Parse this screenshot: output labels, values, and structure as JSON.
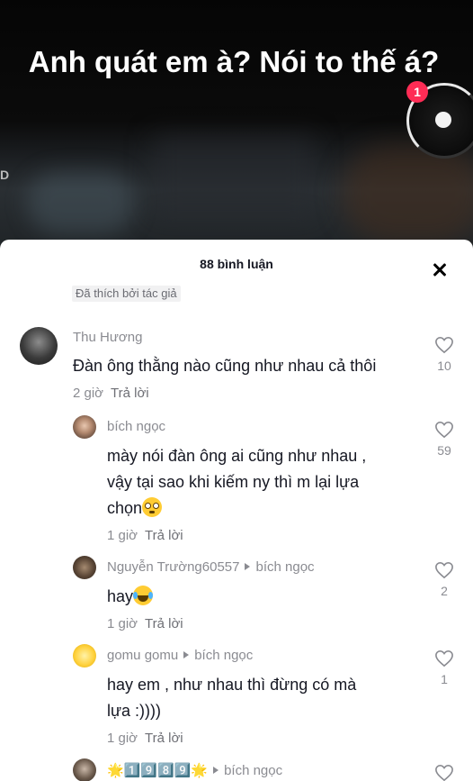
{
  "video": {
    "caption": "Anh quát em à? Nói to thế á?",
    "side_letter": "D",
    "notification_count": "1"
  },
  "sheet": {
    "title": "88 bình luận",
    "liked_by_author": "Đã thích bởi tác giả"
  },
  "comments": [
    {
      "user": "Thu Hương",
      "text": "Đàn ông thằng nào cũng như nhau cả thôi",
      "time": "2 giờ",
      "reply": "Trả lời",
      "likes": "10"
    },
    {
      "user": "bích ngọc",
      "text_line1": "mày nói đàn ông ai cũng như nhau ,",
      "text_line2": "vậy tại sao khi kiếm ny thì m lại lựa",
      "text_line3": "chọn",
      "time": "1 giờ",
      "reply": "Trả lời",
      "likes": "59"
    },
    {
      "user": "Nguyễn Trường60557",
      "reply_to": "bích ngọc",
      "text": "hay",
      "time": "1 giờ",
      "reply": "Trả lời",
      "likes": "2"
    },
    {
      "user": "gomu gomu",
      "reply_to": "bích ngọc",
      "text_line1": "hay em , như nhau thì đừng có mà",
      "text_line2": "lựa :))))",
      "time": "1 giờ",
      "reply": "Trả lời",
      "likes": "1"
    },
    {
      "user": "🌟1️⃣9️⃣8️⃣9️⃣🌟",
      "reply_to": "bích ngọc"
    }
  ],
  "icons": {
    "close": "close-icon",
    "like": "heart-outline-icon",
    "reply_arrow": "triangle-right-icon"
  },
  "colors": {
    "badge": "#fe2c55",
    "secondary_text": "#8a8b91",
    "primary_text": "#161823"
  }
}
